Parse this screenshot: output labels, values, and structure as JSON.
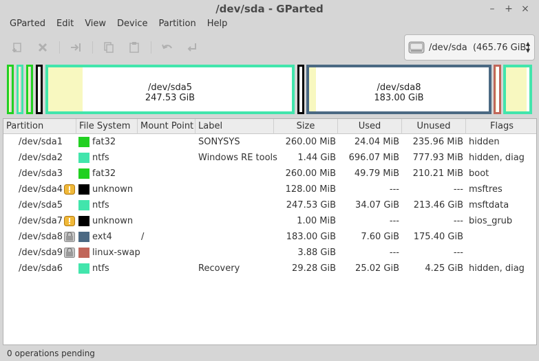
{
  "window": {
    "title": "/dev/sda - GParted"
  },
  "menu": [
    "GParted",
    "Edit",
    "View",
    "Device",
    "Partition",
    "Help"
  ],
  "toolbar": {
    "buttons": [
      "new-icon",
      "delete-icon",
      "resize-move-icon",
      "copy-icon",
      "paste-icon",
      "undo-icon",
      "apply-icon"
    ]
  },
  "device_selector": {
    "label": "/dev/sda  (465.76 GiB)",
    "icon": "hard-disk-icon"
  },
  "diskmap": {
    "sda5": {
      "name": "/dev/sda5",
      "size": "247.53 GiB"
    },
    "sda8": {
      "name": "/dev/sda8",
      "size": "183.00 GiB"
    }
  },
  "table": {
    "headers": [
      "Partition",
      "File System",
      "Mount Point",
      "Label",
      "Size",
      "Used",
      "Unused",
      "Flags"
    ],
    "rows": [
      {
        "partition": "/dev/sda1",
        "status_icon": "",
        "fs": "fat32",
        "fs_color": "#21d021",
        "mount": "",
        "label": "SONYSYS",
        "size": "260.00 MiB",
        "used": "24.04 MiB",
        "unused": "235.96 MiB",
        "flags": "hidden"
      },
      {
        "partition": "/dev/sda2",
        "status_icon": "",
        "fs": "ntfs",
        "fs_color": "#42e5ac",
        "mount": "",
        "label": "Windows RE tools",
        "size": "1.44 GiB",
        "used": "696.07 MiB",
        "unused": "777.93 MiB",
        "flags": "hidden, diag"
      },
      {
        "partition": "/dev/sda3",
        "status_icon": "",
        "fs": "fat32",
        "fs_color": "#21d021",
        "mount": "",
        "label": "",
        "size": "260.00 MiB",
        "used": "49.79 MiB",
        "unused": "210.21 MiB",
        "flags": "boot"
      },
      {
        "partition": "/dev/sda4",
        "status_icon": "warning-icon",
        "fs": "unknown",
        "fs_color": "#000000",
        "mount": "",
        "label": "",
        "size": "128.00 MiB",
        "used": "---",
        "unused": "---",
        "flags": "msftres"
      },
      {
        "partition": "/dev/sda5",
        "status_icon": "",
        "fs": "ntfs",
        "fs_color": "#42e5ac",
        "mount": "",
        "label": "",
        "size": "247.53 GiB",
        "used": "34.07 GiB",
        "unused": "213.46 GiB",
        "flags": "msftdata"
      },
      {
        "partition": "/dev/sda7",
        "status_icon": "warning-icon",
        "fs": "unknown",
        "fs_color": "#000000",
        "mount": "",
        "label": "",
        "size": "1.00 MiB",
        "used": "---",
        "unused": "---",
        "flags": "bios_grub"
      },
      {
        "partition": "/dev/sda8",
        "status_icon": "locked-icon",
        "fs": "ext4",
        "fs_color": "#4b6983",
        "mount": "/",
        "label": "",
        "size": "183.00 GiB",
        "used": "7.60 GiB",
        "unused": "175.40 GiB",
        "flags": ""
      },
      {
        "partition": "/dev/sda9",
        "status_icon": "locked-icon",
        "fs": "linux-swap",
        "fs_color": "#c1665a",
        "mount": "",
        "label": "",
        "size": "3.88 GiB",
        "used": "---",
        "unused": "---",
        "flags": ""
      },
      {
        "partition": "/dev/sda6",
        "status_icon": "",
        "fs": "ntfs",
        "fs_color": "#42e5ac",
        "mount": "",
        "label": "Recovery",
        "size": "29.28 GiB",
        "used": "25.02 GiB",
        "unused": "4.25 GiB",
        "flags": "hidden, diag"
      }
    ]
  },
  "status": {
    "text": "0 operations pending"
  },
  "colors": {
    "ntfs": "#42e5ac",
    "fat32": "#21d021",
    "ext4": "#4b6983",
    "linux_swap": "#c1665a",
    "unknown": "#000000",
    "used": "#f8f8c0"
  }
}
